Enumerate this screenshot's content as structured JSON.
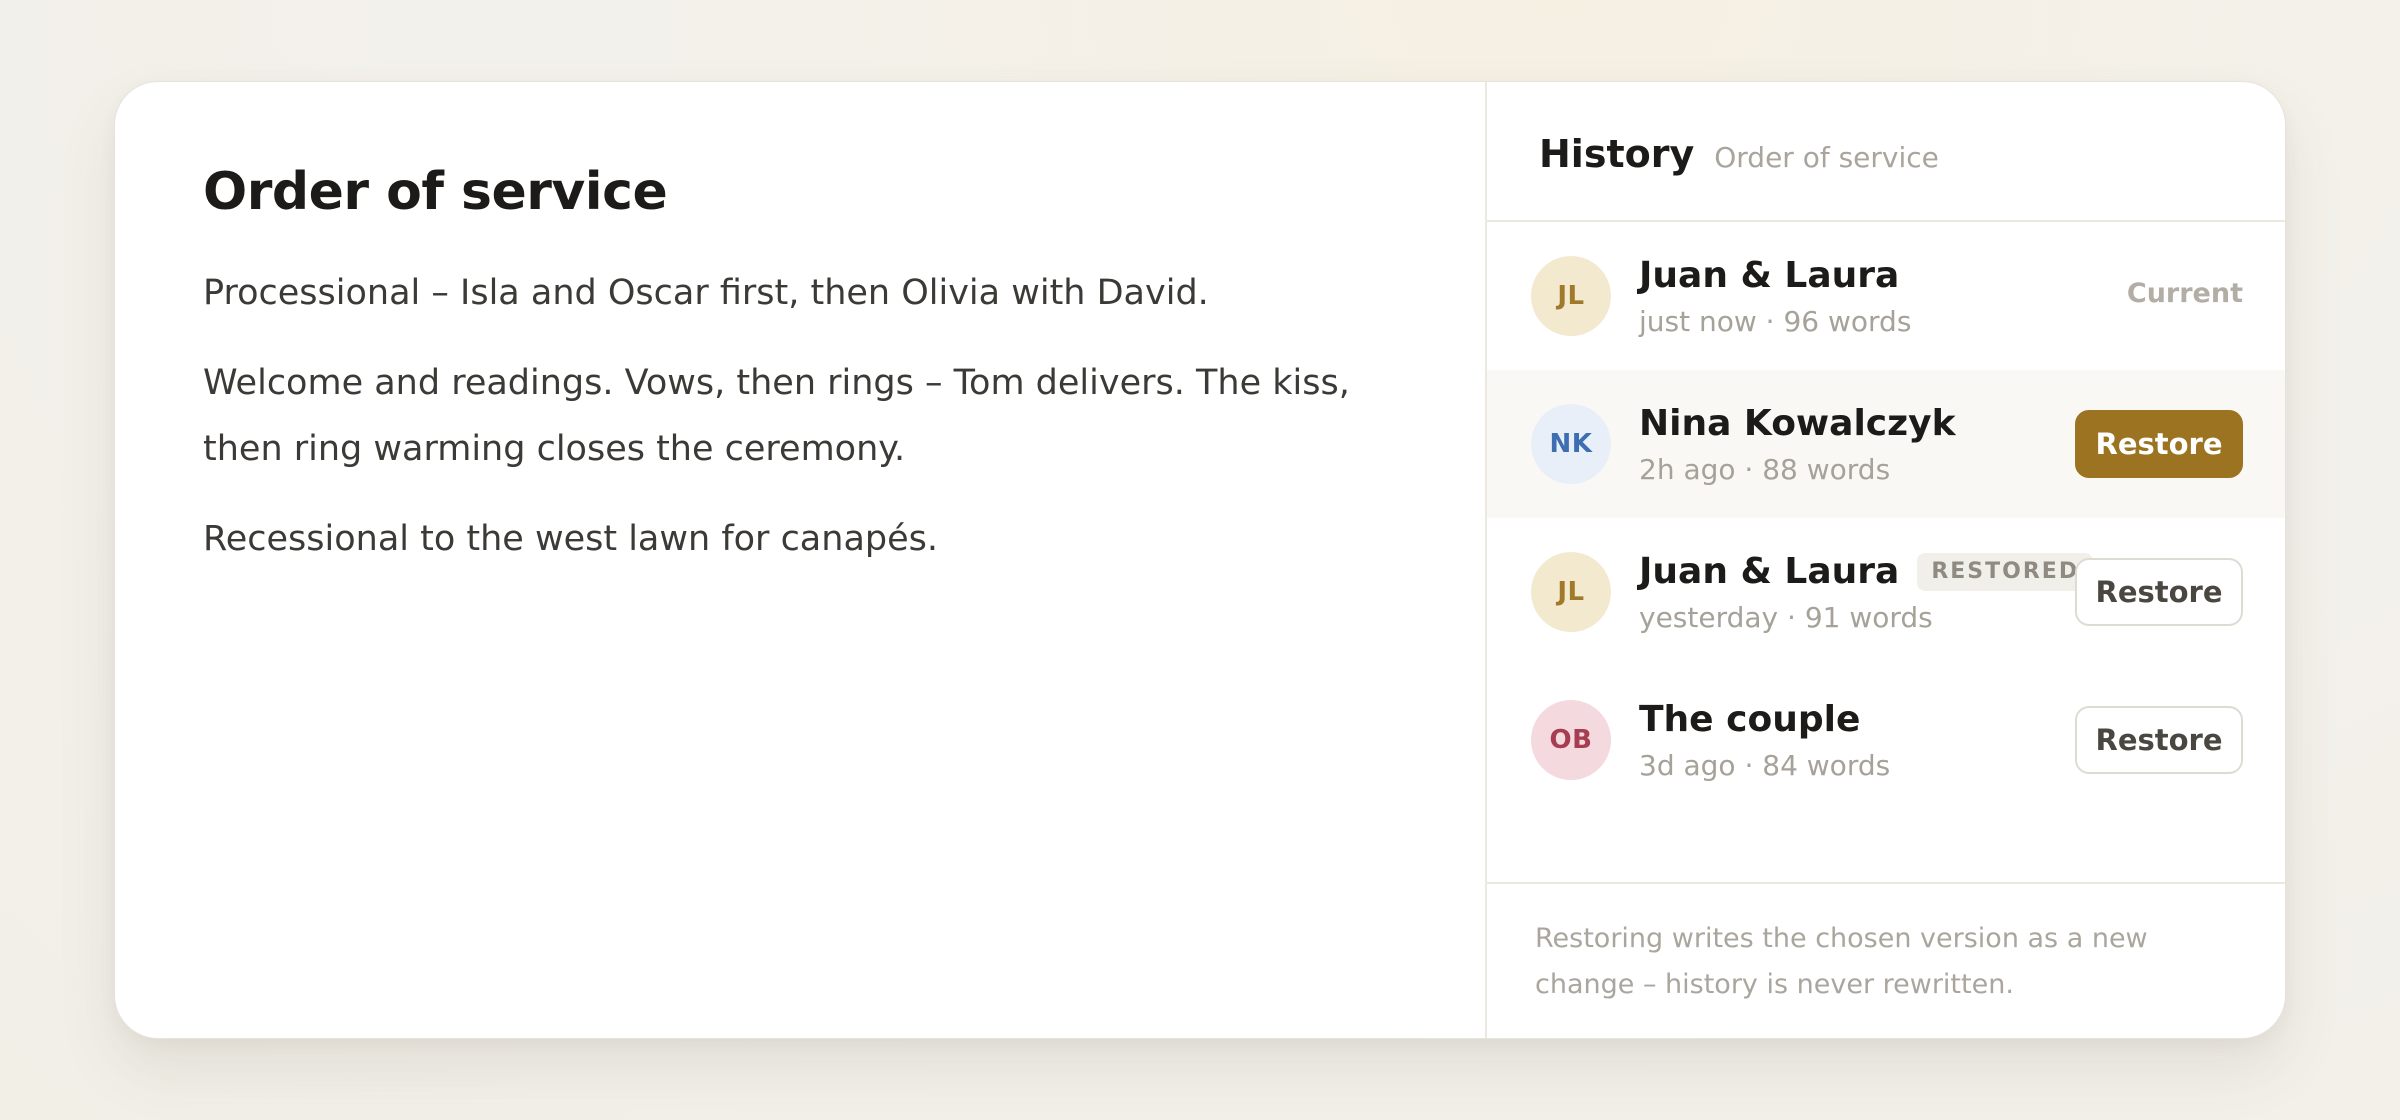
{
  "document": {
    "title": "Order of service",
    "paragraphs": [
      "Processional – Isla and Oscar first, then Olivia with David.",
      "Welcome and readings. Vows, then rings – Tom delivers. The kiss, then ring warming closes the ceremony.",
      "Recessional to the west lawn for canapés."
    ]
  },
  "history": {
    "title": "History",
    "subtitle": "Order of service",
    "versions": [
      {
        "initials": "JL",
        "author": "Juan & Laura",
        "meta": "just now · 96 words",
        "status": "Current",
        "avatar_bg": "#f3e9cf",
        "avatar_fg": "#a07a2a"
      },
      {
        "initials": "NK",
        "author": "Nina Kowalczyk",
        "meta": "2h ago · 88 words",
        "action": "Restore",
        "avatar_bg": "#e8eff8",
        "avatar_fg": "#3d6fb0"
      },
      {
        "initials": "JL",
        "author": "Juan & Laura",
        "badge": "RESTORED",
        "meta": "yesterday · 91 words",
        "action": "Restore",
        "avatar_bg": "#f3e9cf",
        "avatar_fg": "#a07a2a"
      },
      {
        "initials": "OB",
        "author": "The couple",
        "meta": "3d ago · 84 words",
        "action": "Restore",
        "avatar_bg": "#f4d9de",
        "avatar_fg": "#a63d50"
      }
    ],
    "footer_note": "Restoring writes the chosen version as a new change – history is never rewritten."
  },
  "colors": {
    "accent": "#9b7321",
    "background": "#f3f1ec",
    "card": "#ffffff"
  }
}
